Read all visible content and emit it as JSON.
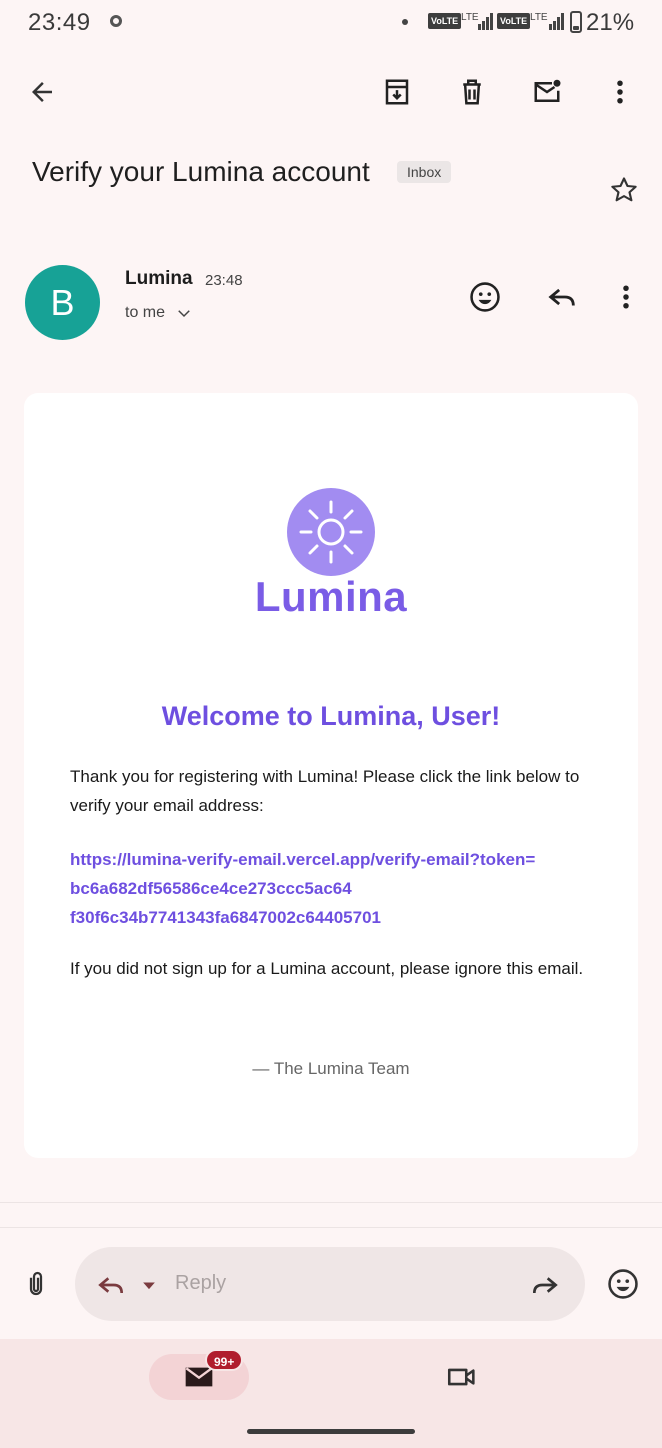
{
  "status_bar": {
    "time": "23:49",
    "net1_badge": "VoLTE",
    "net1_type": "LTE",
    "net2_badge": "VoLTE",
    "net2_type": "LTE",
    "battery_percent": "21%",
    "battery_level": 0.21
  },
  "toolbar": {
    "back_icon": "arrow-back-icon",
    "archive_icon": "archive-icon",
    "delete_icon": "trash-icon",
    "mark_unread_icon": "mail-unread-icon",
    "more_icon": "more-vert-icon"
  },
  "email": {
    "subject": "Verify your Lumina account",
    "label": "Inbox",
    "sender_initial": "B",
    "sender_name": "Lumina",
    "time": "23:48",
    "recipient": "to me"
  },
  "content": {
    "brand": "Lumina",
    "welcome": "Welcome to Lumina, User!",
    "intro": "Thank you for registering with Lumina! Please click the link below to verify your email address:",
    "link": "https://lumina-verify-email.vercel.app/verify-email?token=\nbc6a682df56586ce4ce273ccc5ac64\nf30f6c34b7741343fa6847002c64405701",
    "ignore_note": "If you did not sign up for a Lumina account, please ignore this email.",
    "signoff": "— The Lumina Team"
  },
  "reply_bar": {
    "placeholder": "Reply"
  },
  "bottom_nav": {
    "mail_badge": "99+"
  },
  "colors": {
    "accent": "#6e4fe0",
    "logo": "#a28cf1",
    "avatar": "#17a296",
    "badge": "#b01d2d"
  }
}
